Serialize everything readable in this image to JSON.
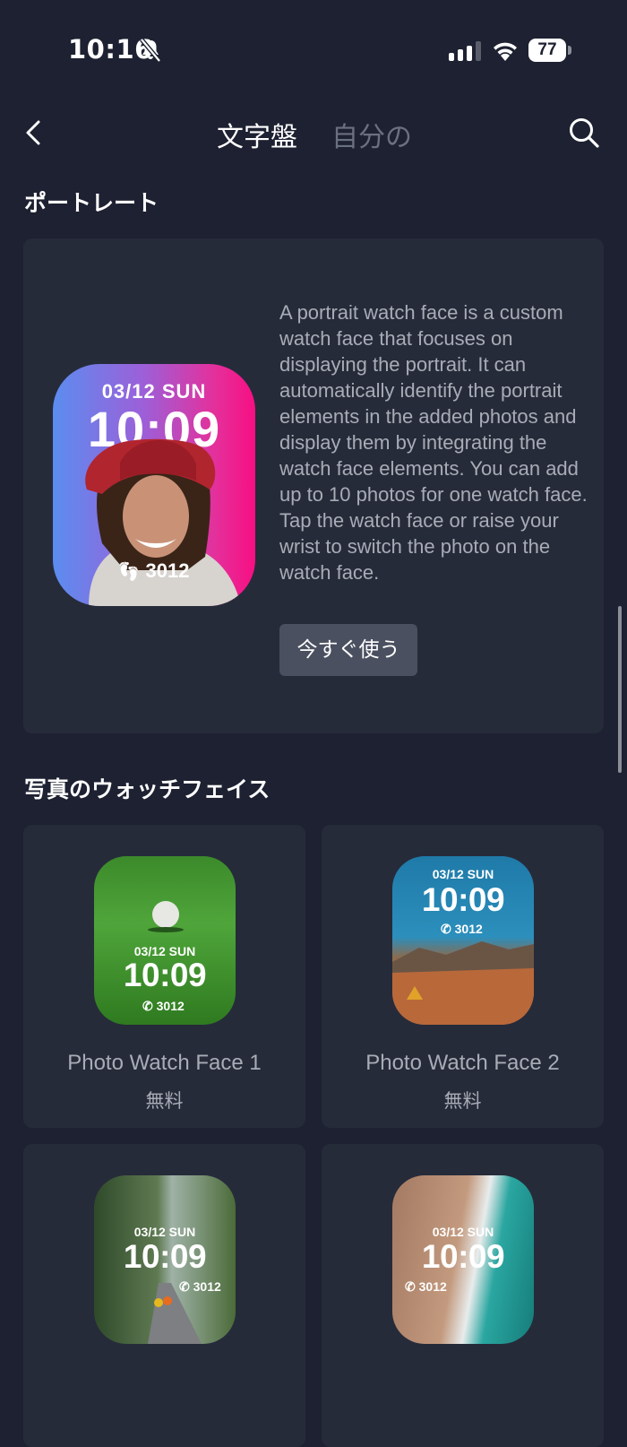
{
  "status_bar": {
    "time": "10:16",
    "battery": "77"
  },
  "nav": {
    "tab_active": "文字盤",
    "tab_inactive": "自分の"
  },
  "portrait_section": {
    "title": "ポートレート",
    "face_date": "03/12  SUN",
    "face_time": "10:09",
    "face_steps": "3012",
    "description": "A portrait watch face is a custom watch face that focuses on displaying the portrait. It can automatically identify the portrait elements in the added photos and display them by integrating the watch face elements. You can add up to 10 photos for one watch face. Tap the watch face or raise your wrist to switch the photo on the watch face.",
    "button": "今すぐ使う"
  },
  "photo_section": {
    "title": "写真のウォッチフェイス",
    "items": [
      {
        "name": "Photo Watch Face 1",
        "price": "無料",
        "date": "03/12   SUN",
        "time": "10:09",
        "steps": "3012"
      },
      {
        "name": "Photo Watch Face 2",
        "price": "無料",
        "date": "03/12   SUN",
        "time": "10:09",
        "steps": "3012"
      },
      {
        "name": "",
        "price": "",
        "date": "03/12   SUN",
        "time": "10:09",
        "steps": "3012"
      },
      {
        "name": "",
        "price": "",
        "date": "03/12   SUN",
        "time": "10:09",
        "steps": "3012"
      }
    ]
  },
  "icons": {
    "back": "chevron-left-icon",
    "search": "search-icon",
    "mute": "bell-slash-icon",
    "signal": "cellular-signal-icon",
    "wifi": "wifi-icon",
    "steps": "footprints-icon",
    "phone": "phone-icon"
  }
}
